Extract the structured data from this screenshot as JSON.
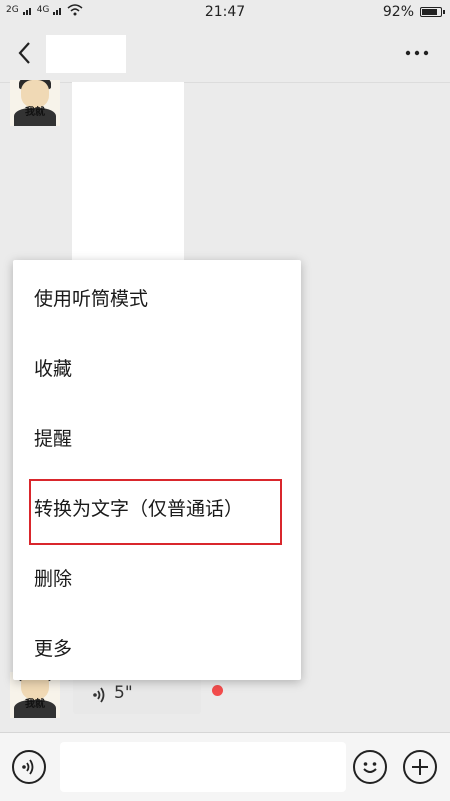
{
  "status_bar": {
    "signal_1": "2G",
    "signal_2": "4G",
    "time": "21:47",
    "battery_text": "92%",
    "battery_level": 0.92
  },
  "nav": {
    "back_icon": "chevron-left-icon",
    "more_icon": "more-dots-icon"
  },
  "avatar": {
    "caption": "我就"
  },
  "menu": {
    "items": [
      {
        "label": "使用听筒模式"
      },
      {
        "label": "收藏"
      },
      {
        "label": "提醒"
      },
      {
        "label": "转换为文字（仅普通话）"
      },
      {
        "label": "删除"
      },
      {
        "label": "更多"
      }
    ],
    "highlight_color": "#d9262c"
  },
  "voice_message": {
    "duration": "5\"",
    "unread_color": "#f24c4c"
  },
  "input_bar": {
    "voice_icon": "voice-icon",
    "emoji_icon": "emoji-icon",
    "plus_icon": "plus-icon",
    "placeholder": ""
  }
}
